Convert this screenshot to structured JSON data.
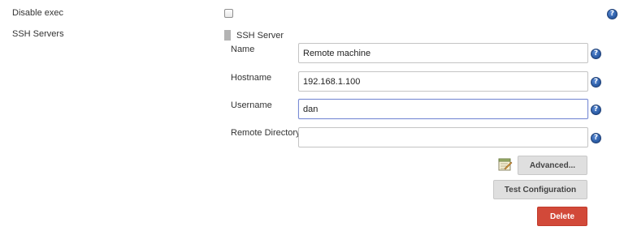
{
  "disable_exec": {
    "label": "Disable exec",
    "checked": false
  },
  "ssh_servers": {
    "label": "SSH Servers",
    "server": {
      "title": "SSH Server",
      "fields": {
        "name": {
          "label": "Name",
          "value": "Remote machine"
        },
        "hostname": {
          "label": "Hostname",
          "value": "192.168.1.100"
        },
        "username": {
          "label": "Username",
          "value": "dan"
        },
        "remote_directory": {
          "label": "Remote Directory",
          "value": ""
        }
      },
      "buttons": {
        "advanced": "Advanced...",
        "test_configuration": "Test Configuration",
        "delete": "Delete"
      }
    }
  },
  "help_glyph": "?",
  "colors": {
    "help_icon": "#2e5fa8",
    "delete_button": "#d24939",
    "focus_border": "#7a8cd4"
  }
}
